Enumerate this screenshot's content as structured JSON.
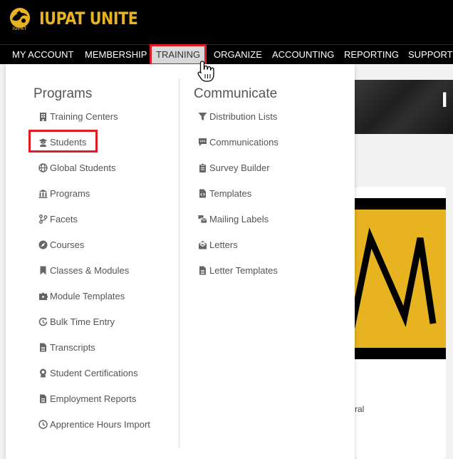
{
  "brand": {
    "title": "IUPAT UNITE",
    "sub": "IUPAT",
    "accent": "#e7b321"
  },
  "nav": {
    "items": [
      "MY ACCOUNT",
      "MEMBERSHIP",
      "TRAINING",
      "ORGANIZE",
      "ACCOUNTING",
      "REPORTING",
      "SUPPORT"
    ],
    "active": "TRAINING"
  },
  "menu": {
    "programs_heading": "Programs",
    "programs": [
      {
        "label": "Training Centers",
        "icon": "building-icon"
      },
      {
        "label": "Students",
        "icon": "graduate-icon"
      },
      {
        "label": "Global Students",
        "icon": "globe-icon"
      },
      {
        "label": "Programs",
        "icon": "institution-icon"
      },
      {
        "label": "Facets",
        "icon": "code-branch-icon"
      },
      {
        "label": "Courses",
        "icon": "compass-icon"
      },
      {
        "label": "Classes & Modules",
        "icon": "bookmark-icon"
      },
      {
        "label": "Module Templates",
        "icon": "puzzle-icon"
      },
      {
        "label": "Bulk Time Entry",
        "icon": "clock-rotate-icon"
      },
      {
        "label": "Transcripts",
        "icon": "file-text-icon"
      },
      {
        "label": "Student Certifications",
        "icon": "certificate-icon"
      },
      {
        "label": "Employment Reports",
        "icon": "file-text-icon"
      },
      {
        "label": "Apprentice Hours Import",
        "icon": "clock-icon"
      }
    ],
    "communicate_heading": "Communicate",
    "communicate": [
      {
        "label": "Distribution Lists",
        "icon": "filter-icon"
      },
      {
        "label": "Communications",
        "icon": "comment-icon"
      },
      {
        "label": "Survey Builder",
        "icon": "clipboard-icon"
      },
      {
        "label": "Templates",
        "icon": "file-code-icon"
      },
      {
        "label": "Mailing Labels",
        "icon": "mail-bulk-icon"
      },
      {
        "label": "Letters",
        "icon": "envelope-open-icon"
      },
      {
        "label": "Letter Templates",
        "icon": "file-text-icon"
      }
    ]
  },
  "background": {
    "banner_letter": "I",
    "fragment": "ral"
  }
}
